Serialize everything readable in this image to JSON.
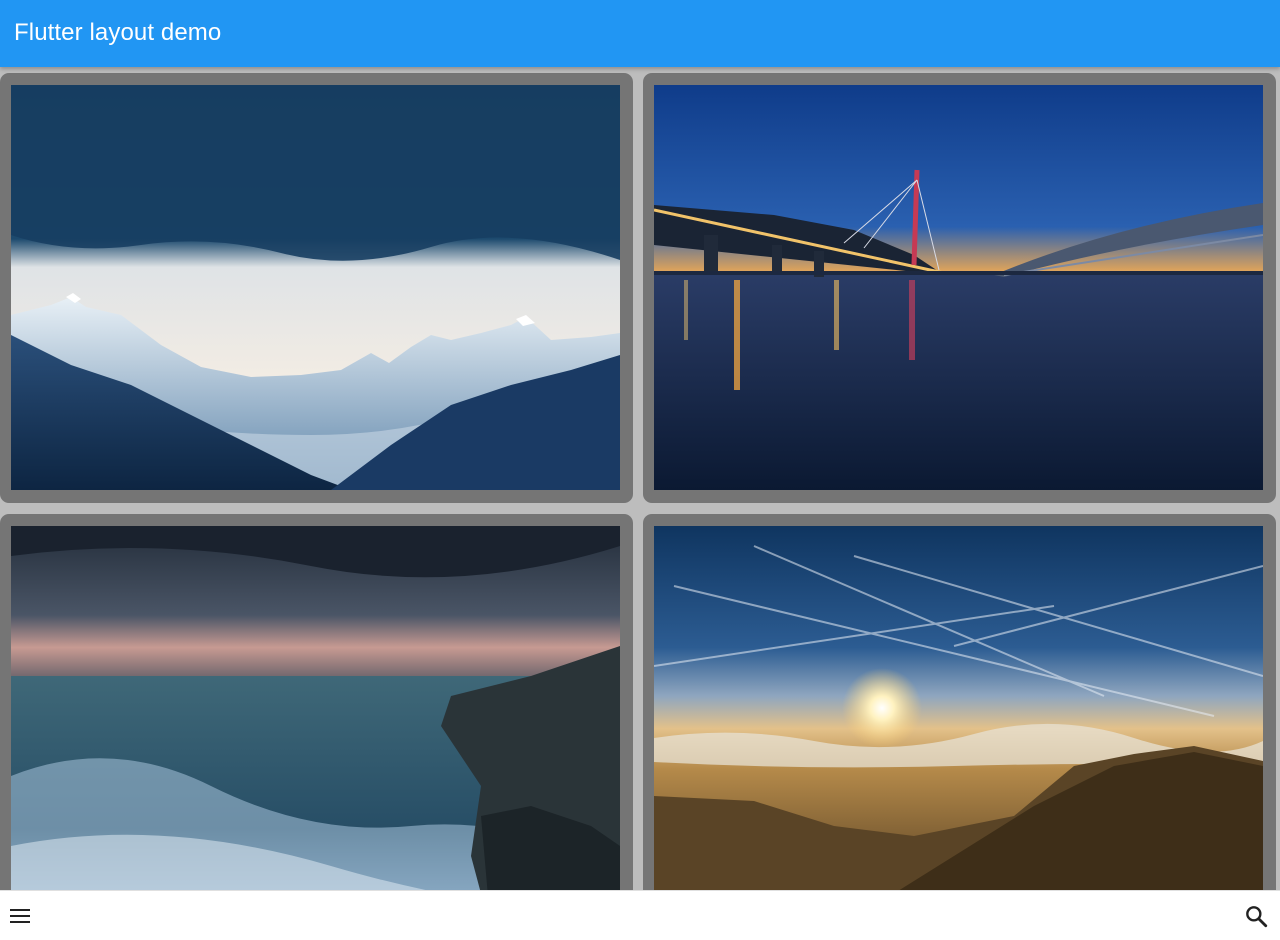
{
  "app_bar": {
    "title": "Flutter layout demo",
    "background_color": "#2196f3",
    "title_color": "#ffffff"
  },
  "grid": {
    "tiles": [
      {
        "subject": "snowy mountain range under dark storm cloud"
      },
      {
        "subject": "illuminated cable-stayed bridge at dusk over calm water"
      },
      {
        "subject": "stormy sea waves crashing on rocky coast"
      },
      {
        "subject": "sunset over sea of clouds with contrails and hillside"
      }
    ]
  },
  "bottom_bar": {
    "left_icon": "menu-icon",
    "right_icon": "search-icon"
  }
}
